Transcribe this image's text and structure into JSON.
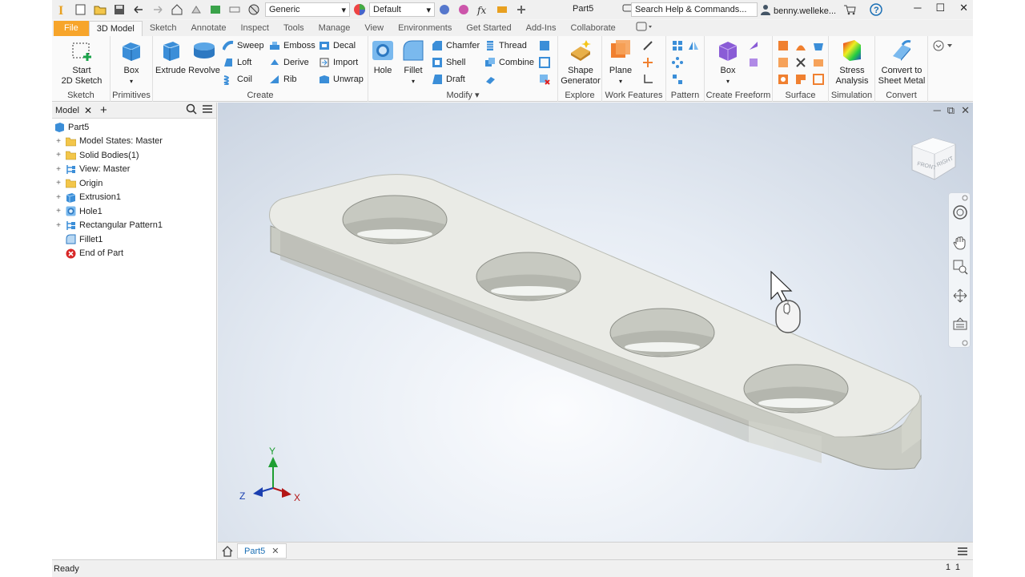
{
  "app": {
    "logo": "inventor-logo-icon",
    "document_title": "Part5"
  },
  "quick_access": {
    "appearance_combo": "Generic",
    "material_combo": "Default"
  },
  "search": {
    "placeholder": "Search Help & Commands..."
  },
  "user": {
    "name": "benny.welleke..."
  },
  "tabs": [
    "File",
    "3D Model",
    "Sketch",
    "Annotate",
    "Inspect",
    "Tools",
    "Manage",
    "View",
    "Environments",
    "Get Started",
    "Add-Ins",
    "Collaborate"
  ],
  "active_tab": "3D Model",
  "ribbon": {
    "sketch": {
      "title": "Sketch",
      "start_2d_sketch": "Start\n2D Sketch"
    },
    "primitives": {
      "title": "Primitives",
      "box": "Box"
    },
    "create": {
      "title": "Create",
      "extrude": "Extrude",
      "revolve": "Revolve",
      "sweep": "Sweep",
      "loft": "Loft",
      "coil": "Coil",
      "emboss": "Emboss",
      "derive": "Derive",
      "rib": "Rib",
      "decal": "Decal",
      "import": "Import",
      "unwrap": "Unwrap"
    },
    "modify": {
      "title": "Modify",
      "hole": "Hole",
      "fillet": "Fillet",
      "chamfer": "Chamfer",
      "shell": "Shell",
      "draft": "Draft",
      "thread": "Thread",
      "combine": "Combine"
    },
    "explore": {
      "title": "Explore",
      "shape_generator": "Shape\nGenerator"
    },
    "work_features": {
      "title": "Work Features",
      "plane": "Plane"
    },
    "pattern": {
      "title": "Pattern"
    },
    "create_freeform": {
      "title": "Create Freeform",
      "box": "Box"
    },
    "surface": {
      "title": "Surface"
    },
    "simulation": {
      "title": "Simulation",
      "stress_analysis": "Stress\nAnalysis"
    },
    "convert": {
      "title": "Convert",
      "convert_to_sheet_metal": "Convert to\nSheet Metal"
    }
  },
  "browser": {
    "tab_label": "Model",
    "root": "Part5",
    "nodes": [
      {
        "label": "Model States: Master",
        "icon": "folder-icon",
        "expandable": true
      },
      {
        "label": "Solid Bodies(1)",
        "icon": "folder-icon",
        "expandable": true
      },
      {
        "label": "View: Master",
        "icon": "view-icon",
        "expandable": true
      },
      {
        "label": "Origin",
        "icon": "folder-icon",
        "expandable": true
      },
      {
        "label": "Extrusion1",
        "icon": "extrusion-icon",
        "expandable": true
      },
      {
        "label": "Hole1",
        "icon": "hole-icon",
        "expandable": true
      },
      {
        "label": "Rectangular Pattern1",
        "icon": "pattern-icon",
        "expandable": true
      },
      {
        "label": "Fillet1",
        "icon": "fillet-icon",
        "expandable": false
      },
      {
        "label": "End of Part",
        "icon": "end-of-part-icon",
        "expandable": false
      }
    ]
  },
  "viewcube": {
    "front": "FRONT",
    "right": "RIGHT"
  },
  "triad": {
    "x": "X",
    "y": "Y",
    "z": "Z"
  },
  "doc_tabs": [
    "Part5"
  ],
  "status": {
    "text": "Ready",
    "counter_a": "1",
    "counter_b": "1"
  }
}
